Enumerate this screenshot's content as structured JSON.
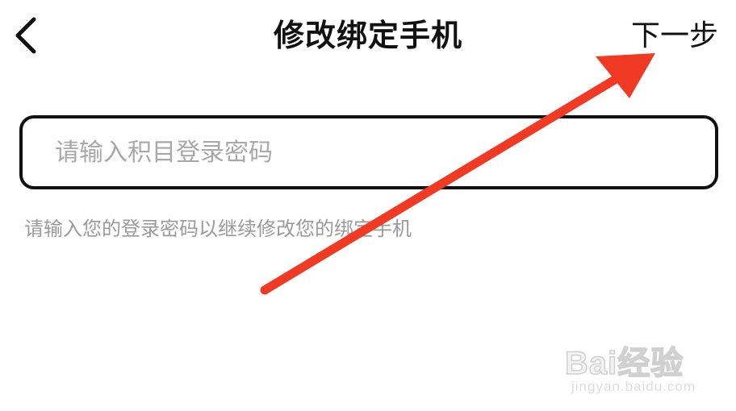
{
  "header": {
    "title": "修改绑定手机",
    "next_label": "下一步",
    "back_icon": "chevron-left-icon"
  },
  "form": {
    "password_placeholder": "请输入积目登录密码",
    "password_value": "",
    "hint": "请输入您的登录密码以继续修改您的绑定手机"
  },
  "annotation": {
    "arrow_color": "#f03a24"
  },
  "watermark": {
    "brand": "Bai经验",
    "url": "jingyan.baidu.com"
  },
  "colors": {
    "title_text": "#111111",
    "placeholder": "#a8a8a8",
    "hint": "#9a9a9a",
    "field_border": "#111111",
    "background": "#ffffff"
  }
}
